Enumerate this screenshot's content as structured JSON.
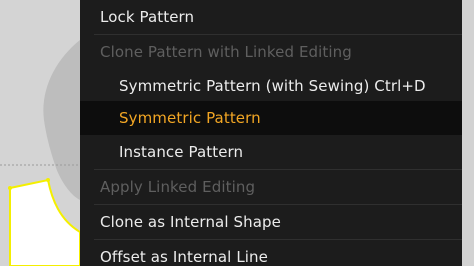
{
  "menu": {
    "items": [
      {
        "label": "Lock Pattern",
        "enabled": true
      },
      {
        "label": "Clone Pattern with Linked Editing",
        "enabled": false
      },
      {
        "label": "Symmetric Pattern (with Sewing) Ctrl+D",
        "enabled": true
      },
      {
        "label": "Symmetric Pattern",
        "enabled": true,
        "highlighted": true
      },
      {
        "label": "Instance Pattern",
        "enabled": true
      },
      {
        "label": "Apply Linked Editing",
        "enabled": false
      },
      {
        "label": "Clone as Internal Shape",
        "enabled": true
      },
      {
        "label": "Offset as Internal Line",
        "enabled": true
      }
    ]
  },
  "colors": {
    "menu_background": "#1c1c1c",
    "highlight_text": "#f2a624",
    "disabled_text": "#5f5f5f",
    "selection_outline": "#f4ef00"
  }
}
